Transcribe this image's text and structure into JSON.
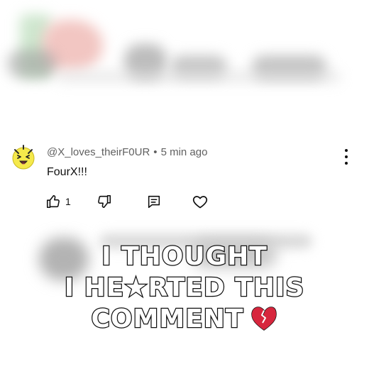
{
  "comment": {
    "username": "@X_loves_theirF0UR",
    "separator": "•",
    "timestamp": "5 min ago",
    "text": "FourX!!!",
    "like_count": "1",
    "avatar_icon": "smiling-face-avatar",
    "avatar_color": "#f5e94b"
  },
  "actions": {
    "like_icon": "thumbs-up-icon",
    "dislike_icon": "thumbs-down-icon",
    "reply_icon": "reply-comment-icon",
    "heart_icon": "heart-icon",
    "more_icon": "kebab-menu-icon"
  },
  "caption": {
    "line1": "I THOUGHT",
    "line2": "I HE★RTED THIS",
    "line3": "COMMENT",
    "emoji": "broken-heart",
    "emoji_color": "#d7263d"
  }
}
